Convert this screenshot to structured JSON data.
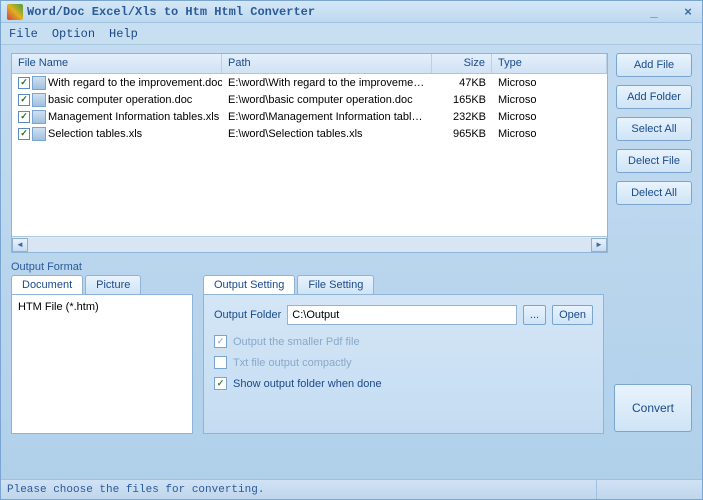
{
  "title": "Word/Doc Excel/Xls to Htm Html Converter",
  "menu": {
    "file": "File",
    "option": "Option",
    "help": "Help"
  },
  "columns": {
    "name": "File Name",
    "path": "Path",
    "size": "Size",
    "type": "Type"
  },
  "files": [
    {
      "checked": true,
      "name": "With regard to the improvement.doc",
      "path": "E:\\word\\With regard to the improvement...",
      "size": "47KB",
      "type": "Microso"
    },
    {
      "checked": true,
      "name": "basic computer operation.doc",
      "path": "E:\\word\\basic computer operation.doc",
      "size": "165KB",
      "type": "Microso"
    },
    {
      "checked": true,
      "name": "Management Information tables.xls",
      "path": "E:\\word\\Management Information tables...",
      "size": "232KB",
      "type": "Microso"
    },
    {
      "checked": true,
      "name": "Selection tables.xls",
      "path": "E:\\word\\Selection tables.xls",
      "size": "965KB",
      "type": "Microso"
    }
  ],
  "sideButtons": {
    "addFile": "Add File",
    "addFolder": "Add Folder",
    "selectAll": "Select All",
    "delectFile": "Delect File",
    "delectAll": "Delect All"
  },
  "outputFormat": {
    "label": "Output Format",
    "tabDocument": "Document",
    "tabPicture": "Picture",
    "item": "HTM File  (*.htm)"
  },
  "outputSetting": {
    "tabSetting": "Output Setting",
    "tabFile": "File Setting",
    "folderLabel": "Output Folder",
    "folderValue": "C:\\Output",
    "browse": "...",
    "open": "Open",
    "opt1": "Output the smaller Pdf file",
    "opt2": "Txt file output compactly",
    "opt3": "Show output folder when done"
  },
  "convert": "Convert",
  "status": "Please choose the files for converting."
}
